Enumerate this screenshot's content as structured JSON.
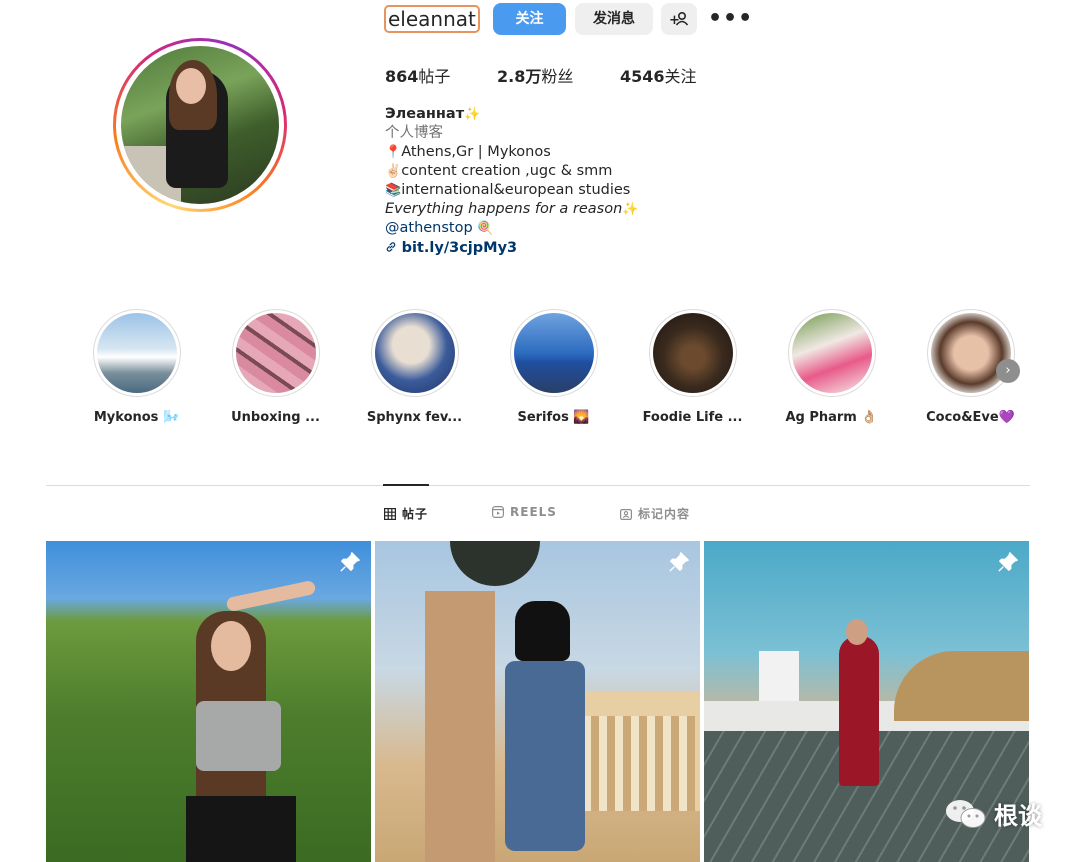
{
  "profile": {
    "username": "eleannat",
    "follow_label": "关注",
    "message_label": "发消息",
    "more_label": "•••",
    "stats": [
      {
        "value": "864",
        "label": "帖子"
      },
      {
        "value": "2.8万",
        "label": "粉丝"
      },
      {
        "value": "4546",
        "label": "关注"
      }
    ],
    "bio": {
      "name": "Элеаннат",
      "name_emoji": "✨",
      "category": "个人博客",
      "line1_emoji": "📍",
      "line1": "Athens,Gr | Mykonos",
      "line2_emoji": "✌🏻",
      "line2": "content creation ,ugc & smm",
      "line3_emoji": "📚",
      "line3": "international&european studies",
      "quote": "Everything happens for a reason",
      "quote_emoji": "✨",
      "mention": "@athenstop",
      "mention_emoji": "🍭",
      "link": "bit.ly/3cjpMy3"
    }
  },
  "highlights": [
    {
      "label": "Mykonos 🌬️"
    },
    {
      "label": "Unboxing ..."
    },
    {
      "label": "Sphynx fev..."
    },
    {
      "label": "Serifos 🌄"
    },
    {
      "label": "Foodie Life ..."
    },
    {
      "label": "Ag Pharm 👌🏼"
    },
    {
      "label": "Coco&Eve💜"
    }
  ],
  "tabs": [
    {
      "label": "帖子"
    },
    {
      "label": "REELS"
    },
    {
      "label": "标记内容"
    }
  ],
  "watermark": {
    "text": "根谈"
  },
  "colors": {
    "accent": "#4a9bf0",
    "button_gray": "#efefef",
    "link": "#00376b",
    "muted": "#737373"
  }
}
